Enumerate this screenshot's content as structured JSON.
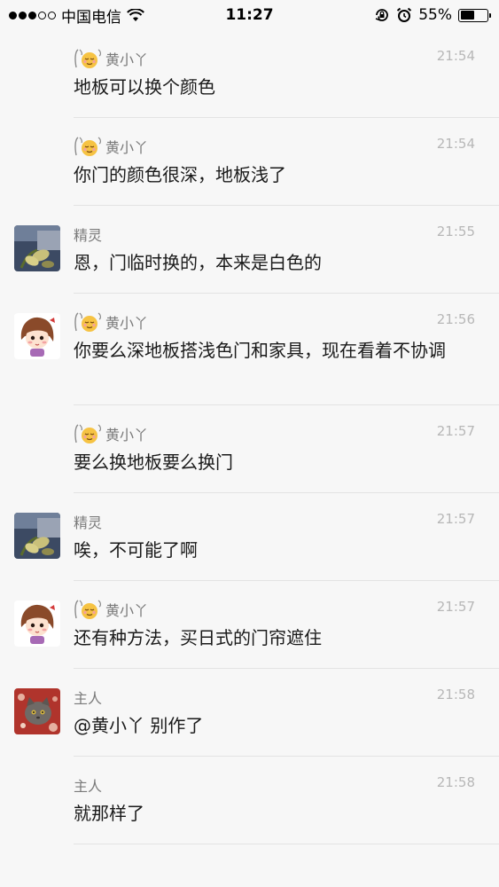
{
  "status_bar": {
    "carrier": "中国电信",
    "time": "11:27",
    "battery": "55%",
    "battery_level": 0.55
  },
  "messages": [
    {
      "sender": "黄小丫",
      "time": "21:54",
      "text": "地板可以换个颜色",
      "avatar": "none",
      "emoji": true
    },
    {
      "sender": "黄小丫",
      "time": "21:54",
      "text": "你门的颜色很深，地板浅了",
      "avatar": "none",
      "emoji": true
    },
    {
      "sender": "精灵",
      "time": "21:55",
      "text": "恩，门临时换的，本来是白色的",
      "avatar": "plant-photo",
      "emoji": false
    },
    {
      "sender": "黄小丫",
      "time": "21:56",
      "text": "你要么深地板搭浅色门和家具，现在看着不协调",
      "avatar": "cartoon-girl",
      "emoji": true
    },
    {
      "sender": "黄小丫",
      "time": "21:57",
      "text": "要么换地板要么换门",
      "avatar": "none",
      "emoji": true
    },
    {
      "sender": "精灵",
      "time": "21:57",
      "text": "唉，不可能了啊",
      "avatar": "plant-photo",
      "emoji": false
    },
    {
      "sender": "黄小丫",
      "time": "21:57",
      "text": "还有种方法，买日式的门帘遮住",
      "avatar": "cartoon-girl",
      "emoji": true
    },
    {
      "sender": "主人",
      "time": "21:58",
      "text": "别作了",
      "mention": "@黄小丫",
      "avatar": "cat-photo",
      "emoji": false
    },
    {
      "sender": "主人",
      "time": "21:58",
      "text": "就那样了",
      "avatar": "none",
      "emoji": false
    }
  ]
}
